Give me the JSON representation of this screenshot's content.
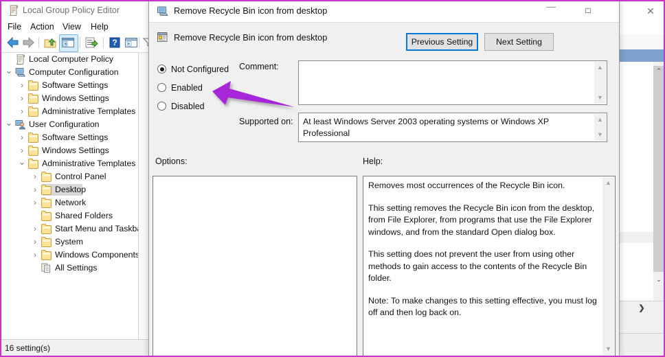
{
  "gpe_window": {
    "title": "Local Group Policy Editor",
    "title_icon": "policy-scroll-icon",
    "menus": [
      {
        "label": "File"
      },
      {
        "label": "Action"
      },
      {
        "label": "View"
      },
      {
        "label": "Help"
      }
    ],
    "toolbar_icons": [
      "back-arrow-icon",
      "forward-arrow-icon",
      "up-one-level-icon",
      "show-hide-console-tree-icon",
      "export-list-icon",
      "help-question-icon",
      "properties-icon",
      "filter-funnel-icon"
    ],
    "tree": [
      {
        "label": "Local Computer Policy",
        "depth": 0,
        "chevron": "",
        "icon": "policy-scroll-icon",
        "selected": false
      },
      {
        "label": "Computer Configuration",
        "depth": 0,
        "chevron": "expanded",
        "icon": "computer-icon",
        "selected": false
      },
      {
        "label": "Software Settings",
        "depth": 1,
        "chevron": "collapsed",
        "icon": "folder-icon",
        "selected": false
      },
      {
        "label": "Windows Settings",
        "depth": 1,
        "chevron": "collapsed",
        "icon": "folder-icon",
        "selected": false
      },
      {
        "label": "Administrative Templates",
        "depth": 1,
        "chevron": "collapsed",
        "icon": "folder-icon",
        "selected": false
      },
      {
        "label": "User Configuration",
        "depth": 0,
        "chevron": "expanded",
        "icon": "user-config-icon",
        "selected": false
      },
      {
        "label": "Software Settings",
        "depth": 1,
        "chevron": "collapsed",
        "icon": "folder-icon",
        "selected": false
      },
      {
        "label": "Windows Settings",
        "depth": 1,
        "chevron": "collapsed",
        "icon": "folder-icon",
        "selected": false
      },
      {
        "label": "Administrative Templates",
        "depth": 1,
        "chevron": "expanded",
        "icon": "folder-icon",
        "selected": false
      },
      {
        "label": "Control Panel",
        "depth": 2,
        "chevron": "collapsed",
        "icon": "folder-icon",
        "selected": false
      },
      {
        "label": "Desktop",
        "depth": 2,
        "chevron": "collapsed",
        "icon": "folder-icon",
        "selected": true
      },
      {
        "label": "Network",
        "depth": 2,
        "chevron": "collapsed",
        "icon": "folder-icon",
        "selected": false
      },
      {
        "label": "Shared Folders",
        "depth": 2,
        "chevron": "",
        "icon": "folder-icon",
        "selected": false
      },
      {
        "label": "Start Menu and Taskbar",
        "depth": 2,
        "chevron": "collapsed",
        "icon": "folder-icon",
        "selected": false
      },
      {
        "label": "System",
        "depth": 2,
        "chevron": "collapsed",
        "icon": "folder-icon",
        "selected": false
      },
      {
        "label": "Windows Components",
        "depth": 2,
        "chevron": "collapsed",
        "icon": "folder-icon",
        "selected": false
      },
      {
        "label": "All Settings",
        "depth": 2,
        "chevron": "",
        "icon": "all-settings-icon",
        "selected": false
      }
    ],
    "status_text": "16 setting(s)"
  },
  "dialog": {
    "title": "Remove Recycle Bin icon from desktop",
    "title_icon": "computer-icon",
    "header_title": "Remove Recycle Bin icon from desktop",
    "header_icon": "policy-setting-icon",
    "minimize_glyph": "—",
    "maximize_glyph": "□",
    "close_glyph": "✕",
    "previous_setting_label": "Previous Setting",
    "next_setting_label": "Next Setting",
    "state_options": [
      {
        "label": "Not Configured",
        "selected": true
      },
      {
        "label": "Enabled",
        "selected": false
      },
      {
        "label": "Disabled",
        "selected": false
      }
    ],
    "comment_label": "Comment:",
    "comment_value": "",
    "supported_on_label": "Supported on:",
    "supported_on_value": "At least Windows Server 2003 operating systems or Windows XP Professional",
    "options_label": "Options:",
    "help_label": "Help:",
    "help_paragraphs": [
      "Removes most occurrences of the Recycle Bin icon.",
      "This setting removes the Recycle Bin icon from the desktop, from File Explorer, from programs that use the File Explorer windows, and from the standard Open dialog box.",
      "This setting does not prevent the user from using other methods to gain access to the contents of the Recycle Bin folder.",
      "Note: To make changes to this setting effective, you must log off and then log back on."
    ]
  },
  "annotation": {
    "arrow_color": "#a726d9",
    "arrow_points_to": "Enabled"
  },
  "background_window": {
    "close_glyph": "✕",
    "expand_glyph": "❯",
    "scroll_up_glyph": "⌃",
    "scroll_down_glyph": "⌄"
  },
  "colors": {
    "page_border": "#cc33cc",
    "dialog_face": "#f0f0f0",
    "focus_blue": "#0078d7",
    "selection_gray": "#d8d8d8",
    "bg_selection_blue": "#7da2ce"
  }
}
